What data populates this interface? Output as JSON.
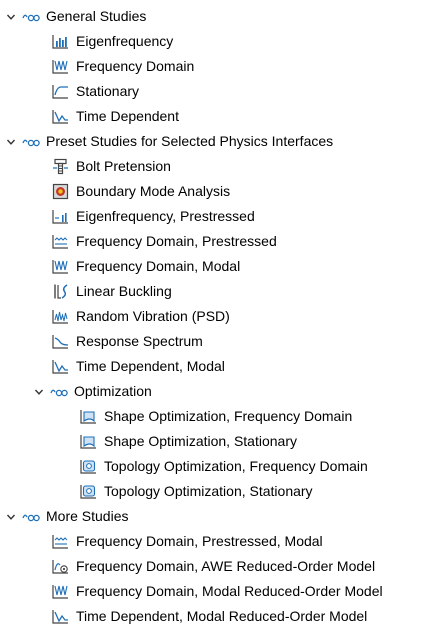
{
  "tree": {
    "groups": [
      {
        "label": "General Studies",
        "items": [
          {
            "label": "Eigenfrequency",
            "icon": "eigenfrequency-icon"
          },
          {
            "label": "Frequency Domain",
            "icon": "frequency-domain-icon"
          },
          {
            "label": "Stationary",
            "icon": "stationary-icon"
          },
          {
            "label": "Time Dependent",
            "icon": "time-dependent-icon"
          }
        ]
      },
      {
        "label": "Preset Studies for Selected Physics Interfaces",
        "items": [
          {
            "label": "Bolt Pretension",
            "icon": "bolt-pretension-icon"
          },
          {
            "label": "Boundary Mode Analysis",
            "icon": "boundary-mode-analysis-icon"
          },
          {
            "label": "Eigenfrequency, Prestressed",
            "icon": "eigenfrequency-prestressed-icon"
          },
          {
            "label": "Frequency Domain, Prestressed",
            "icon": "frequency-domain-prestressed-icon"
          },
          {
            "label": "Frequency Domain, Modal",
            "icon": "frequency-domain-modal-icon"
          },
          {
            "label": "Linear Buckling",
            "icon": "linear-buckling-icon"
          },
          {
            "label": "Random Vibration (PSD)",
            "icon": "random-vibration-icon"
          },
          {
            "label": "Response Spectrum",
            "icon": "response-spectrum-icon"
          },
          {
            "label": "Time Dependent, Modal",
            "icon": "time-dependent-modal-icon"
          }
        ],
        "subgroup": {
          "label": "Optimization",
          "items": [
            {
              "label": "Shape Optimization, Frequency Domain",
              "icon": "shape-optimization-icon"
            },
            {
              "label": "Shape Optimization, Stationary",
              "icon": "shape-optimization-icon"
            },
            {
              "label": "Topology Optimization, Frequency Domain",
              "icon": "topology-optimization-icon"
            },
            {
              "label": "Topology Optimization, Stationary",
              "icon": "topology-optimization-icon"
            }
          ]
        }
      },
      {
        "label": "More Studies",
        "items": [
          {
            "label": "Frequency Domain, Prestressed, Modal",
            "icon": "frequency-domain-prestressed-icon"
          },
          {
            "label": "Frequency Domain, AWE Reduced-Order Model",
            "icon": "awe-reduced-order-icon"
          },
          {
            "label": "Frequency Domain, Modal Reduced-Order Model",
            "icon": "frequency-domain-modal-icon"
          },
          {
            "label": "Time Dependent, Modal Reduced-Order Model",
            "icon": "time-dependent-modal-icon"
          }
        ]
      }
    ]
  },
  "colors": {
    "icon_blue": "#1f6fb8",
    "icon_dark": "#444444",
    "chevron": "#333333"
  }
}
